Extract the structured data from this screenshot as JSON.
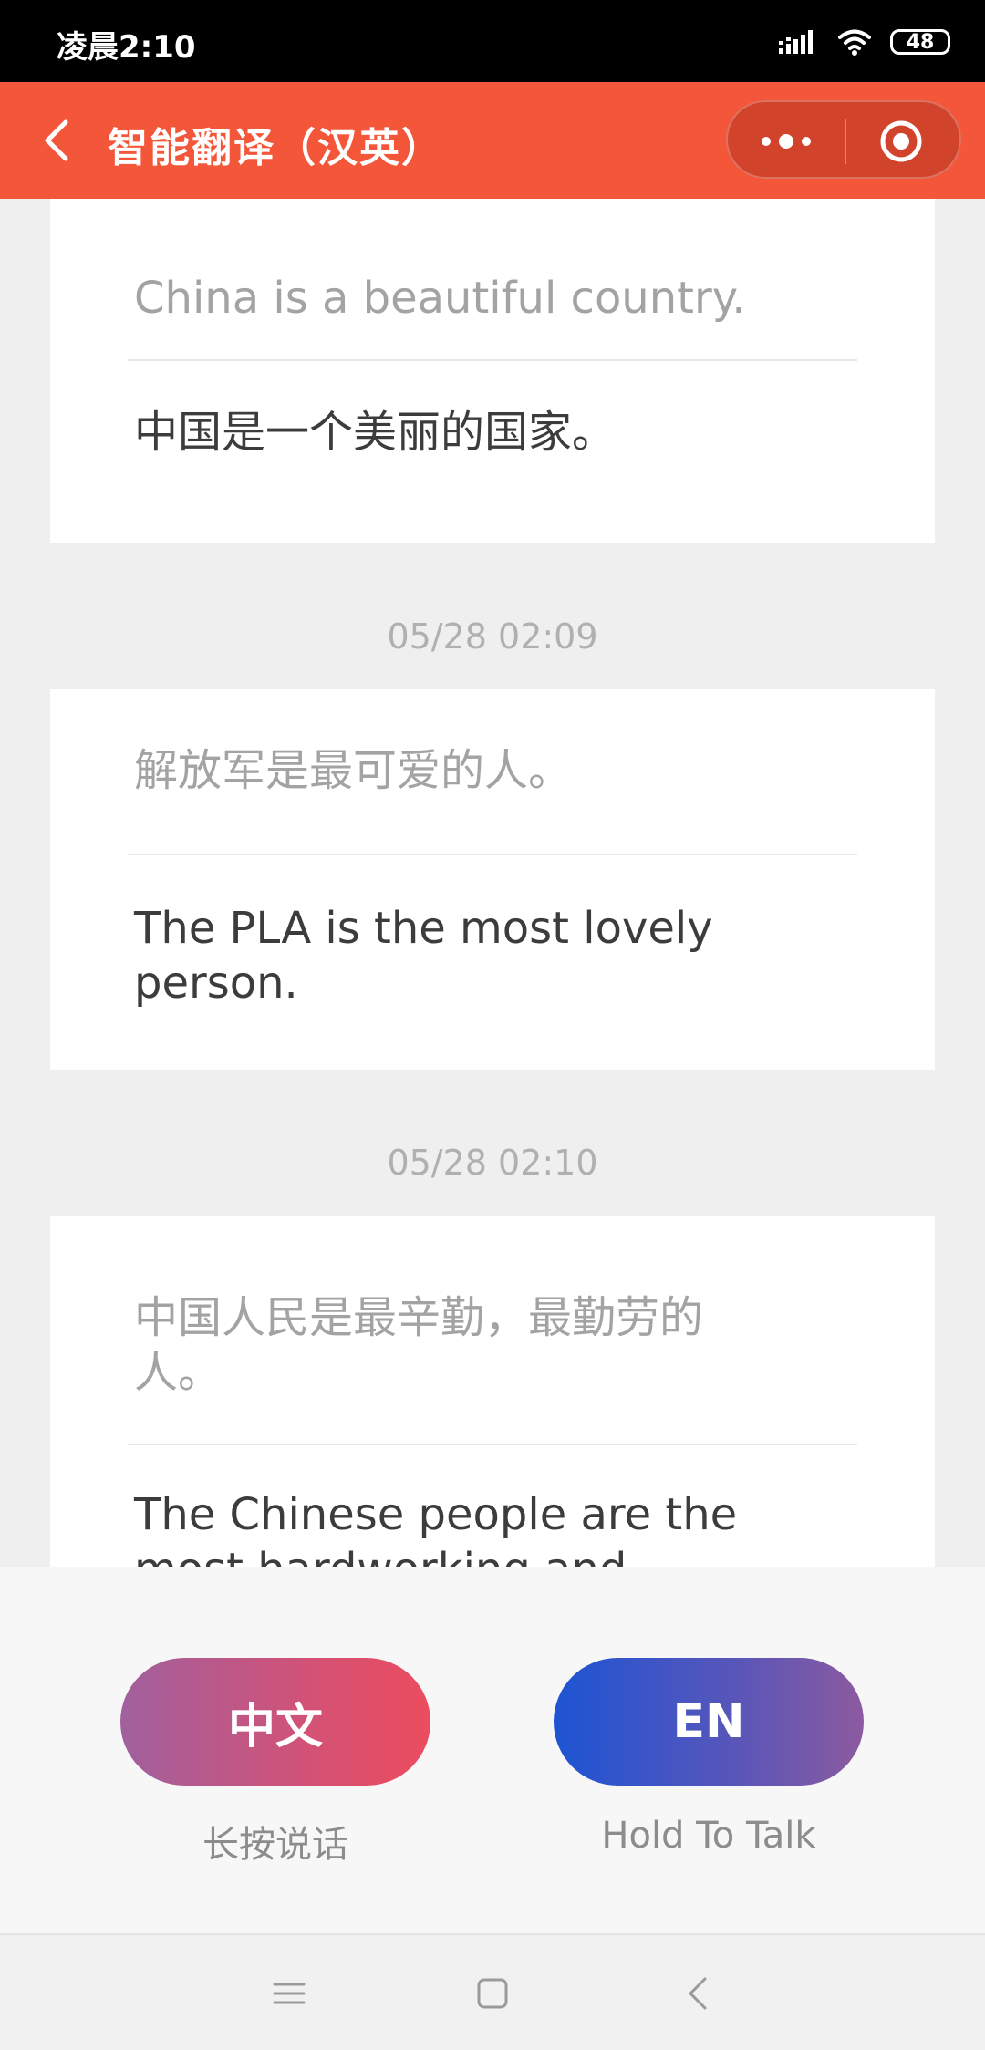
{
  "status_bar": {
    "time": "凌晨2:10",
    "battery": "48"
  },
  "header": {
    "title": "智能翻译（汉英）",
    "icons": {
      "back": "back-arrow-icon",
      "more": "more-dots-icon",
      "close": "target-close-icon"
    }
  },
  "conversation": {
    "cards": [
      {
        "source": "China is a beautiful country.",
        "translation": "中国是一个美丽的国家。"
      },
      {
        "source": "解放军是最可爱的人。",
        "translation": "The PLA is the most lovely person."
      },
      {
        "source": "中国人民是最辛勤，最勤劳的人。",
        "translation": "The Chinese people are the most hardworking and"
      }
    ],
    "timestamps": [
      "05/28 02:09",
      "05/28 02:10"
    ]
  },
  "talk_buttons": {
    "chinese": {
      "label": "中文",
      "hint": "长按说话"
    },
    "english": {
      "label": "EN",
      "hint": "Hold To Talk"
    }
  },
  "colors": {
    "header": "#f4563a",
    "zh_button_start": "#a0609e",
    "zh_button_end": "#ec4c5e",
    "en_button_start": "#1e54d4",
    "en_button_end": "#8c5aa0"
  }
}
